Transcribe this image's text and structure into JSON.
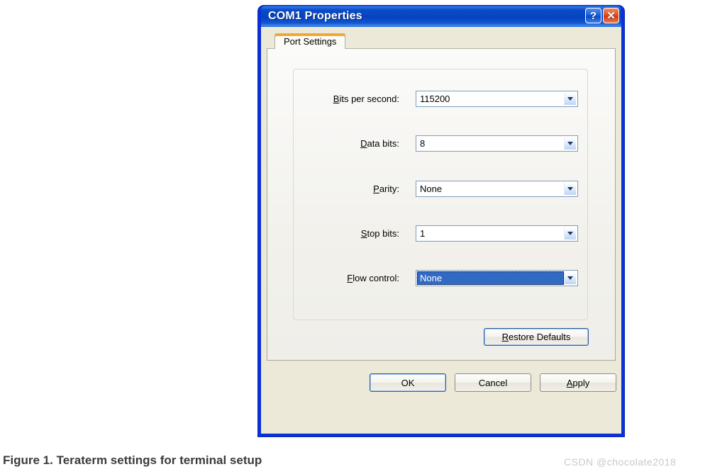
{
  "window": {
    "title": "COM1 Properties",
    "help_button": "?",
    "close_button": "✕"
  },
  "tabs": [
    {
      "label": "Port Settings",
      "selected": true
    }
  ],
  "settings_group": {
    "rows": [
      {
        "label_prefix": "",
        "label_accel": "B",
        "label_suffix": "its per second:",
        "value": "115200",
        "focused": false,
        "name": "bits-per-second"
      },
      {
        "label_prefix": "",
        "label_accel": "D",
        "label_suffix": "ata bits:",
        "value": "8",
        "focused": false,
        "name": "data-bits"
      },
      {
        "label_prefix": "",
        "label_accel": "P",
        "label_suffix": "arity:",
        "value": "None",
        "focused": false,
        "name": "parity"
      },
      {
        "label_prefix": "",
        "label_accel": "S",
        "label_suffix": "top bits:",
        "value": "1",
        "focused": false,
        "name": "stop-bits"
      },
      {
        "label_prefix": "",
        "label_accel": "F",
        "label_suffix": "low control:",
        "value": "None",
        "focused": true,
        "name": "flow-control"
      }
    ]
  },
  "buttons": {
    "restore_defaults": {
      "accel": "R",
      "rest": "estore Defaults"
    },
    "ok": {
      "accel": "",
      "rest": "OK"
    },
    "cancel": {
      "accel": "",
      "rest": "Cancel"
    },
    "apply": {
      "accel": "A",
      "rest": "pply"
    }
  },
  "caption": "Figure 1.  Teraterm settings for terminal setup",
  "watermark": "CSDN @chocolate2018",
  "colors": {
    "titlebar_blue": "#0642c0",
    "client_beige": "#ece9d8",
    "selection_blue": "#316ac5",
    "close_red": "#cf3a15",
    "tab_accent_orange": "#f5a623"
  }
}
